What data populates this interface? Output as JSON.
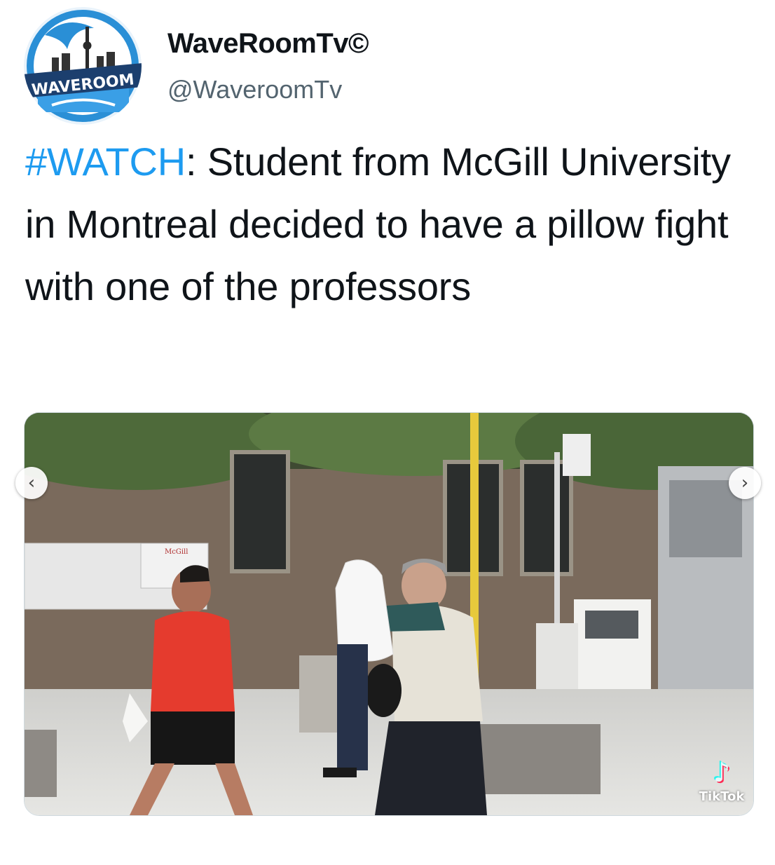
{
  "account": {
    "display_name": "WaveRoomTv©",
    "handle": "@WaveroomTv",
    "avatar_label": "WAVEROOM"
  },
  "tweet": {
    "hashtag": "#WATCH",
    "text": ": Student from McGill University in Montreal decided to have a pillow fight with one of the professors"
  },
  "media": {
    "prev_icon": "‹",
    "next_icon": "›",
    "watermark": "TikTok",
    "sign_text": "McGill"
  },
  "colors": {
    "hashtag": "#1d9bf0",
    "handle": "#53646f"
  }
}
